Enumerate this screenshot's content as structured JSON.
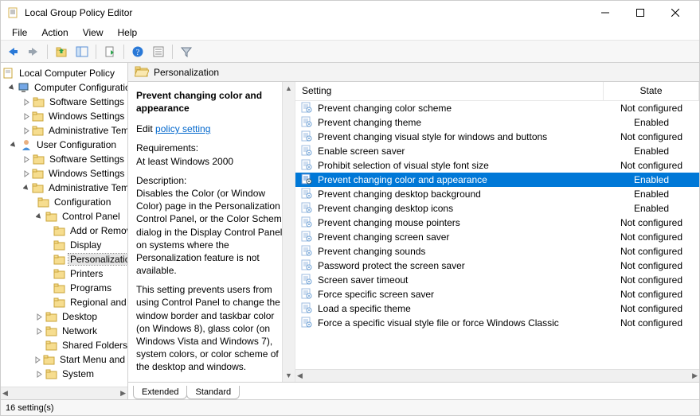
{
  "window": {
    "title": "Local Group Policy Editor"
  },
  "menu": {
    "file": "File",
    "action": "Action",
    "view": "View",
    "help": "Help"
  },
  "breadcrumb": {
    "label": "Personalization"
  },
  "detail": {
    "title": "Prevent changing color and appearance",
    "edit_prefix": "Edit",
    "edit_link": "policy setting",
    "req_label": "Requirements:",
    "req_value": "At least Windows 2000",
    "desc_label": "Description:",
    "desc_p1": "Disables the Color (or Window Color) page in the Personalization Control Panel, or the Color Scheme dialog in the Display Control Panel on systems where the Personalization feature is not available.",
    "desc_p2": "This setting prevents users from using Control Panel to change the window border and taskbar color (on Windows 8), glass color (on Windows Vista and Windows 7), system colors, or color scheme of the desktop and windows."
  },
  "columns": {
    "setting": "Setting",
    "state": "State"
  },
  "tree": {
    "root": "Local Computer Policy",
    "computer_config": "Computer Configuration",
    "cc_software": "Software Settings",
    "cc_windows": "Windows Settings",
    "cc_admin": "Administrative Templates",
    "user_config": "User Configuration",
    "uc_software": "Software Settings",
    "uc_windows": "Windows Settings",
    "uc_admin": "Administrative Templates",
    "configuration": "Configuration",
    "control_panel": "Control Panel",
    "add_or": "Add or Remove Programs",
    "display": "Display",
    "personalization": "Personalization",
    "printers": "Printers",
    "programs": "Programs",
    "regional": "Regional and Language Options",
    "desktop": "Desktop",
    "network": "Network",
    "shared_folders": "Shared Folders",
    "start_menu": "Start Menu and Taskbar",
    "system": "System"
  },
  "settings": [
    {
      "name": "Prevent changing color scheme",
      "state": "Not configured"
    },
    {
      "name": "Prevent changing theme",
      "state": "Enabled"
    },
    {
      "name": "Prevent changing visual style for windows and buttons",
      "state": "Not configured"
    },
    {
      "name": "Enable screen saver",
      "state": "Enabled"
    },
    {
      "name": "Prohibit selection of visual style font size",
      "state": "Not configured"
    },
    {
      "name": "Prevent changing color and appearance",
      "state": "Enabled",
      "selected": true
    },
    {
      "name": "Prevent changing desktop background",
      "state": "Enabled"
    },
    {
      "name": "Prevent changing desktop icons",
      "state": "Enabled"
    },
    {
      "name": "Prevent changing mouse pointers",
      "state": "Not configured"
    },
    {
      "name": "Prevent changing screen saver",
      "state": "Not configured"
    },
    {
      "name": "Prevent changing sounds",
      "state": "Not configured"
    },
    {
      "name": "Password protect the screen saver",
      "state": "Not configured"
    },
    {
      "name": "Screen saver timeout",
      "state": "Not configured"
    },
    {
      "name": "Force specific screen saver",
      "state": "Not configured"
    },
    {
      "name": "Load a specific theme",
      "state": "Not configured"
    },
    {
      "name": "Force a specific visual style file or force Windows Classic",
      "state": "Not configured"
    }
  ],
  "tabs": {
    "extended": "Extended",
    "standard": "Standard"
  },
  "status": {
    "text": "16 setting(s)"
  }
}
